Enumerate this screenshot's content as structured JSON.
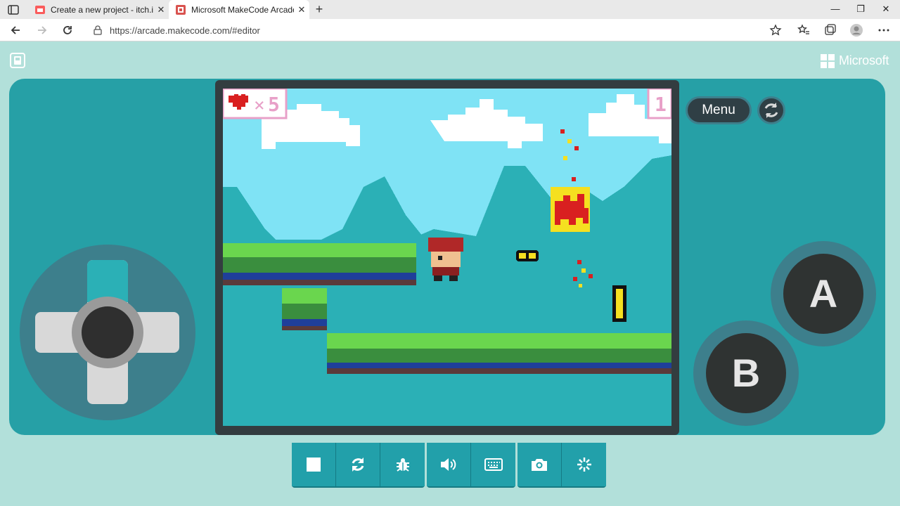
{
  "browser": {
    "tabs": [
      {
        "title": "Create a new project - itch.io",
        "active": false
      },
      {
        "title": "Microsoft MakeCode Arcade",
        "active": true
      }
    ],
    "url": "https://arcade.makecode.com/#editor"
  },
  "page": {
    "brand": "Microsoft",
    "menu_label": "Menu",
    "button_a": "A",
    "button_b": "B"
  },
  "game": {
    "lives_symbol": "×",
    "lives": "5",
    "score": "1"
  },
  "toolbar": {
    "groups": [
      [
        "stop-icon",
        "restart-icon",
        "debug-icon"
      ],
      [
        "sound-icon",
        "keyboard-icon"
      ],
      [
        "screenshot-icon",
        "record-icon"
      ]
    ]
  },
  "colors": {
    "console": "#26a0a6",
    "page_bg": "#b2e0da",
    "sky": "#7fe3f5",
    "mountain": "#2bb0b6",
    "grass": "#6ad64e",
    "button": "#2f3332"
  }
}
